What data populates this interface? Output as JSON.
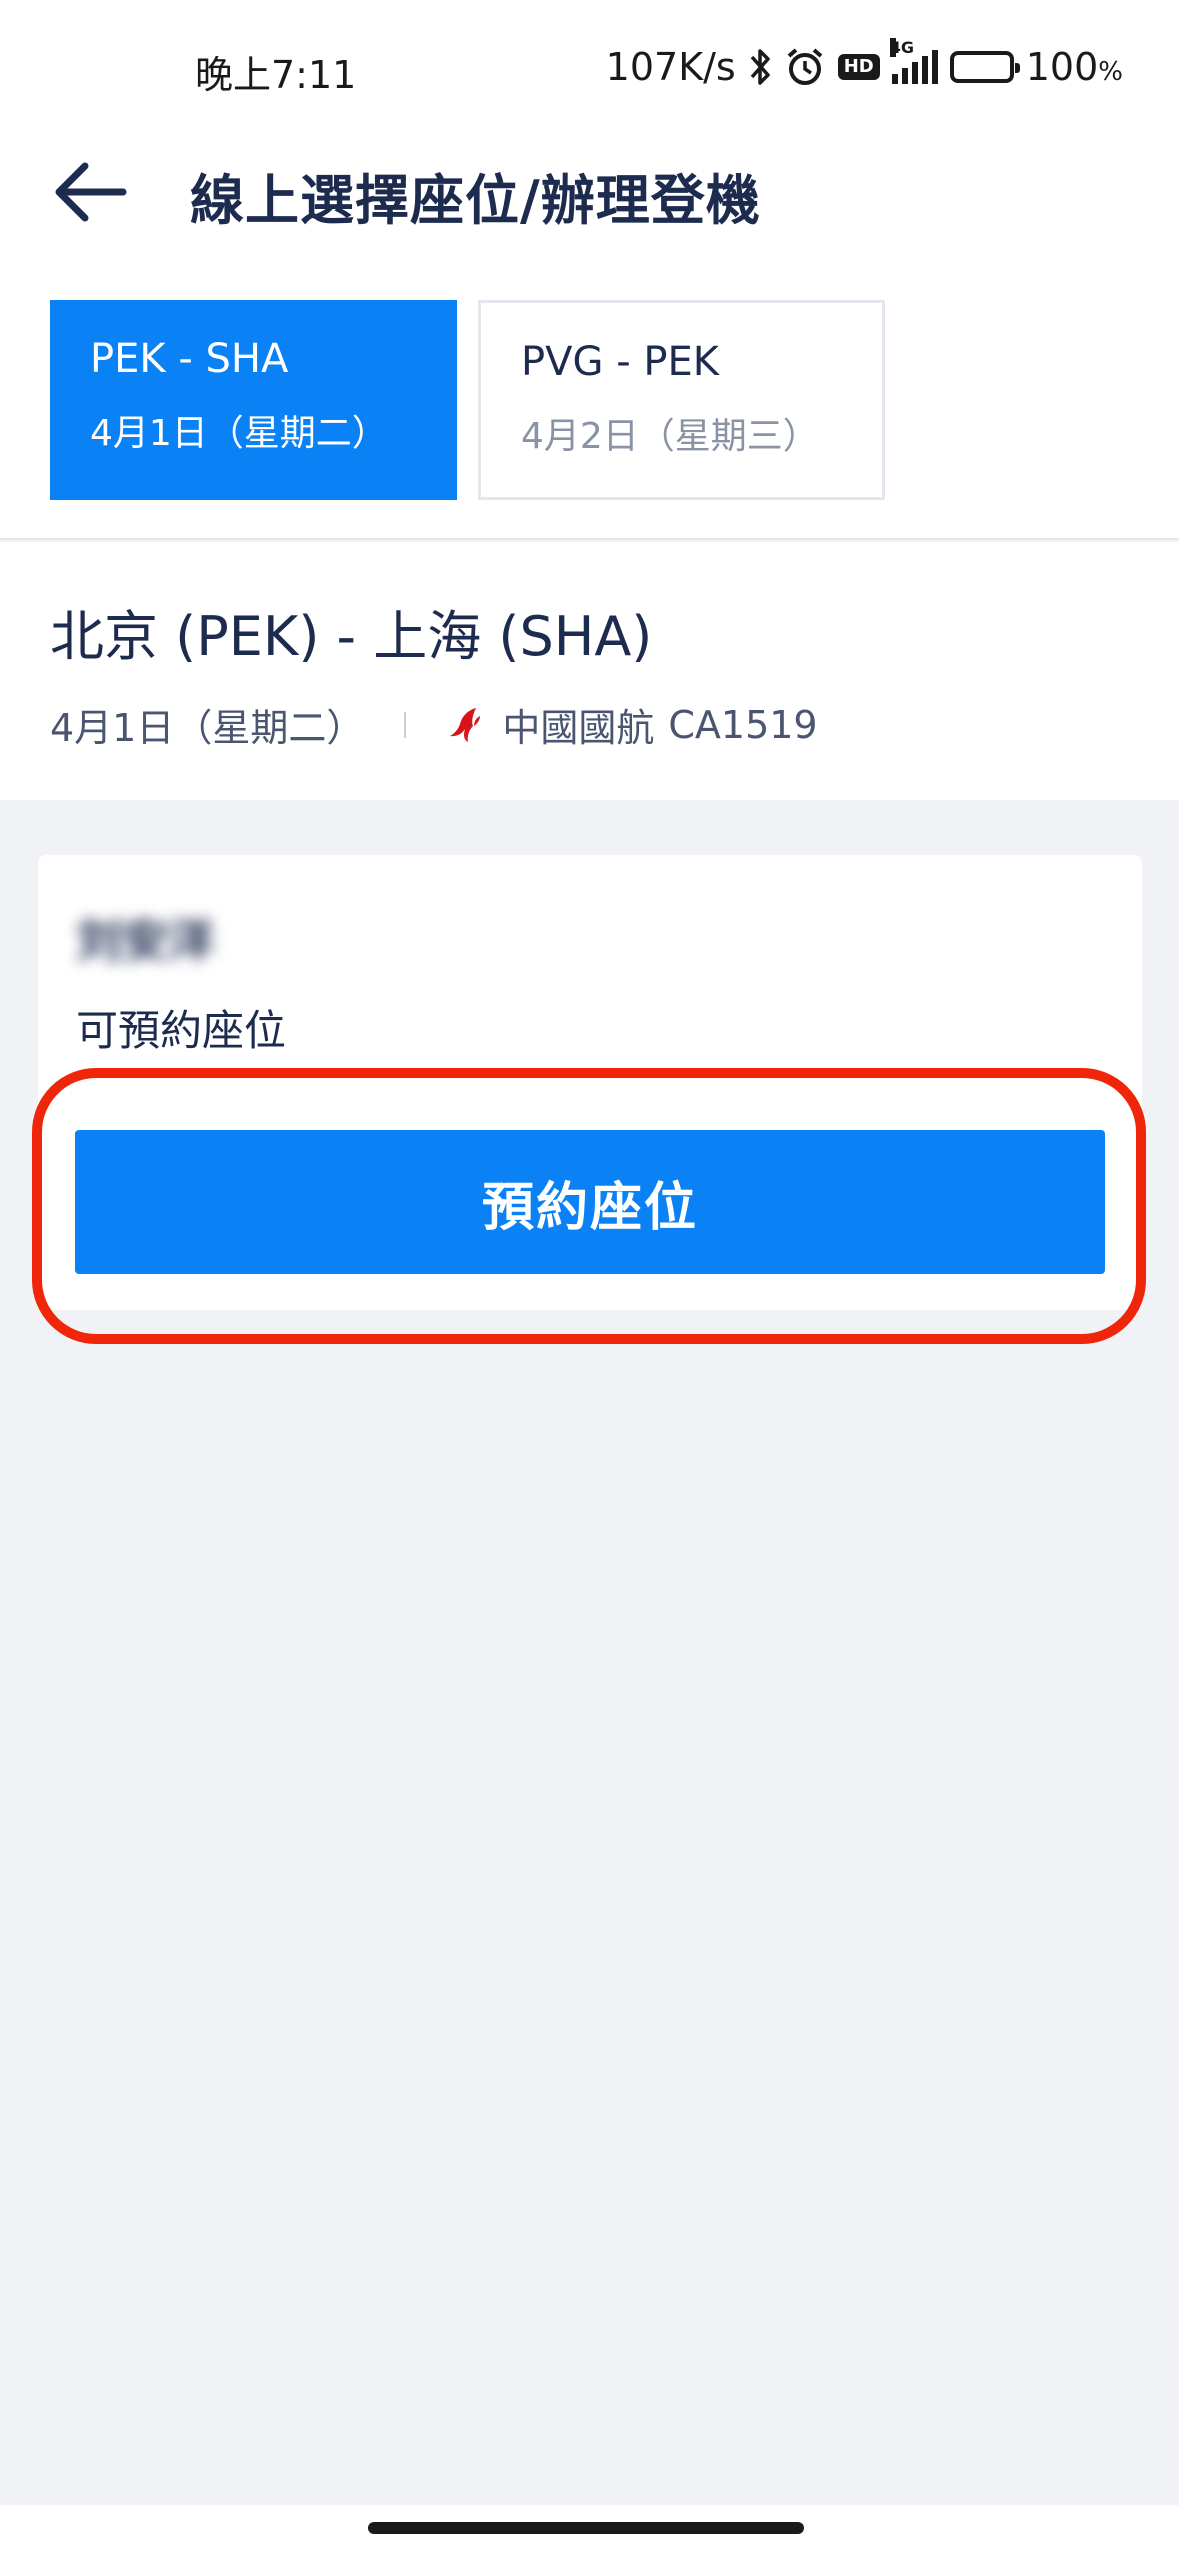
{
  "status_bar": {
    "time": "晚上7:11",
    "network_speed": "107K/s",
    "hd_label": "HD",
    "signal_label": "4G",
    "battery_percent": "100",
    "battery_unit": "%",
    "battery_level": 1.0,
    "icons": [
      "bluetooth-icon",
      "alarm-icon",
      "hd-icon",
      "signal-icon",
      "battery-icon"
    ]
  },
  "header": {
    "title": "線上選擇座位/辦理登機",
    "back_icon": "arrow-left-icon"
  },
  "segments": [
    {
      "route": "PEK - SHA",
      "date": "4月1日（星期二）",
      "active": true
    },
    {
      "route": "PVG - PEK",
      "date": "4月2日（星期三）",
      "active": false
    }
  ],
  "flight": {
    "route": "北京 (PEK) - 上海 (SHA)",
    "date": "4月1日（星期二）",
    "airline": "中國國航",
    "flight_number": "CA1519",
    "airline_logo_icon": "air-china-logo-icon"
  },
  "passenger": {
    "name": "刘安洋",
    "status": "可預約座位",
    "action_label": "預約座位"
  },
  "colors": {
    "primary": "#0a82f5",
    "text": "#1d2b4f",
    "highlight": "#f0260a",
    "background": "#f0f2f6"
  }
}
